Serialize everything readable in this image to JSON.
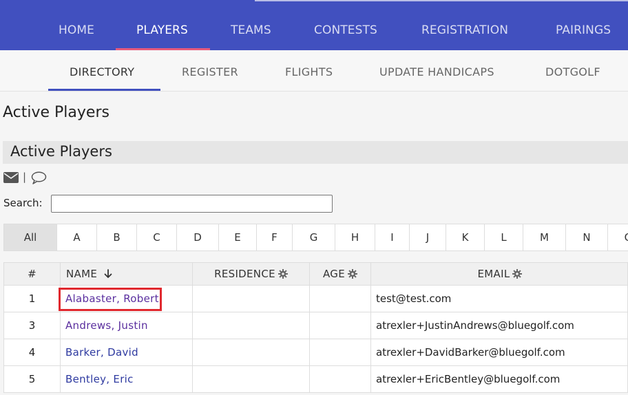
{
  "top_nav": {
    "items": [
      {
        "label": "HOME",
        "active": false
      },
      {
        "label": "PLAYERS",
        "active": true
      },
      {
        "label": "TEAMS",
        "active": false
      },
      {
        "label": "CONTESTS",
        "active": false
      },
      {
        "label": "REGISTRATION",
        "active": false
      },
      {
        "label": "PAIRINGS",
        "active": false
      }
    ]
  },
  "sub_nav": {
    "items": [
      {
        "label": "DIRECTORY",
        "active": true
      },
      {
        "label": "REGISTER",
        "active": false
      },
      {
        "label": "FLIGHTS",
        "active": false
      },
      {
        "label": "UPDATE HANDICAPS",
        "active": false
      },
      {
        "label": "DOTGOLF",
        "active": false
      }
    ]
  },
  "page": {
    "title": "Active Players",
    "section_title": "Active Players"
  },
  "tools": {
    "separator": "|",
    "icons": [
      "envelope-icon",
      "comment-icon"
    ]
  },
  "search": {
    "label": "Search:",
    "value": "",
    "placeholder": ""
  },
  "letters": [
    "All",
    "A",
    "B",
    "C",
    "D",
    "E",
    "F",
    "G",
    "H",
    "I",
    "J",
    "K",
    "L",
    "M",
    "N",
    "O"
  ],
  "table": {
    "headers": {
      "num": "#",
      "name": "NAME",
      "residence": "RESIDENCE",
      "age": "AGE",
      "email": "EMAIL"
    },
    "rows": [
      {
        "num": "1",
        "name": "Alabaster, Robert",
        "residence": "",
        "age": "",
        "email": "test@test.com"
      },
      {
        "num": "3",
        "name": "Andrews, Justin",
        "residence": "",
        "age": "",
        "email": "atrexler+JustinAndrews@bluegolf.com"
      },
      {
        "num": "4",
        "name": "Barker, David",
        "residence": "",
        "age": "",
        "email": "atrexler+DavidBarker@bluegolf.com"
      },
      {
        "num": "5",
        "name": "Bentley, Eric",
        "residence": "",
        "age": "",
        "email": "atrexler+EricBentley@bluegolf.com"
      }
    ]
  },
  "colors": {
    "nav_bg": "#4150bf",
    "active_underline": "#e75a7c",
    "sub_underline": "#4150bf",
    "highlight": "#e0282e",
    "link": "#5a2e9e"
  }
}
